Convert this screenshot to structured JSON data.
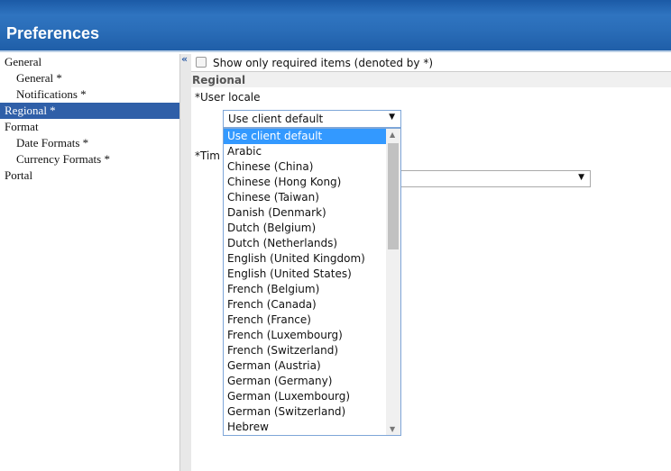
{
  "header": {
    "title": "Preferences"
  },
  "sidebar": {
    "collapse_label": "«",
    "items": [
      {
        "label": "General",
        "sub": false,
        "selected": false
      },
      {
        "label": "General *",
        "sub": true,
        "selected": false
      },
      {
        "label": "Notifications *",
        "sub": true,
        "selected": false
      },
      {
        "label": "Regional *",
        "sub": false,
        "selected": true
      },
      {
        "label": "Format",
        "sub": false,
        "selected": false
      },
      {
        "label": "Date Formats *",
        "sub": true,
        "selected": false
      },
      {
        "label": "Currency Formats *",
        "sub": true,
        "selected": false
      },
      {
        "label": "Portal",
        "sub": false,
        "selected": false
      }
    ]
  },
  "main": {
    "required_checkbox_label": "Show only required items (denoted by *)",
    "required_checked": false,
    "section": "Regional",
    "user_locale_label": "*User locale",
    "user_locale_value": "Use client default",
    "timezone_label": "*Tim"
  },
  "dropdown": {
    "options": [
      "Use client default",
      "Arabic",
      "Chinese (China)",
      "Chinese (Hong Kong)",
      "Chinese (Taiwan)",
      "Danish (Denmark)",
      "Dutch (Belgium)",
      "Dutch (Netherlands)",
      "English (United Kingdom)",
      "English (United States)",
      "French (Belgium)",
      "French (Canada)",
      "French (France)",
      "French (Luxembourg)",
      "French (Switzerland)",
      "German (Austria)",
      "German (Germany)",
      "German (Luxembourg)",
      "German (Switzerland)",
      "Hebrew"
    ],
    "highlighted": "Use client default"
  }
}
